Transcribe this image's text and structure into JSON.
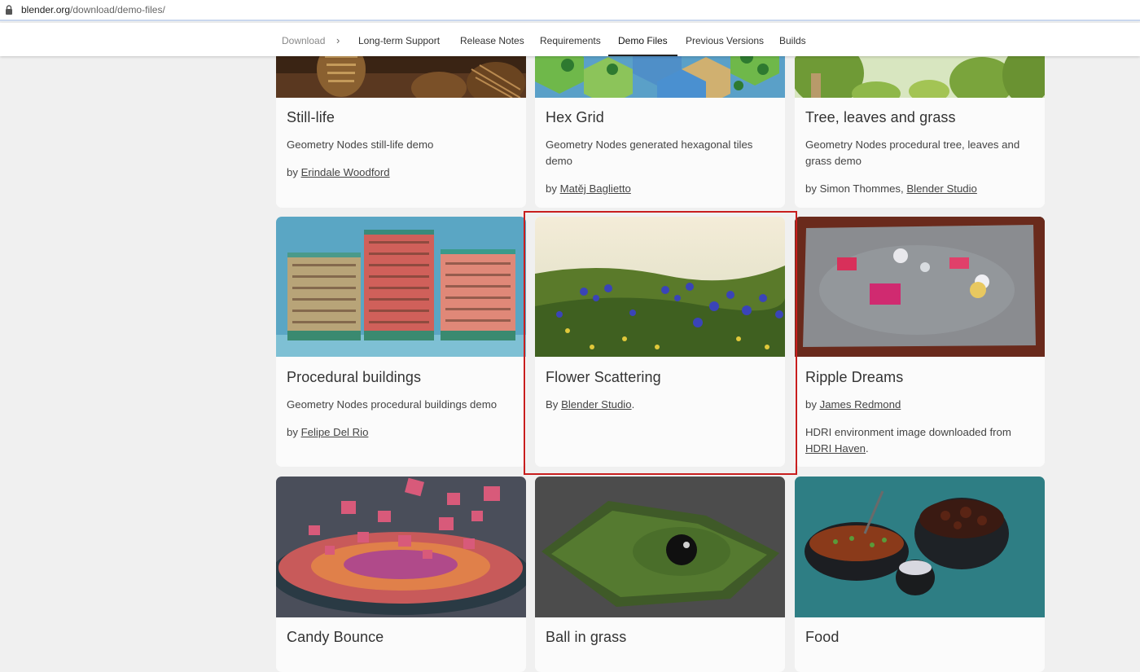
{
  "browser": {
    "url_host": "blender.org",
    "url_path": "/download/demo-files/"
  },
  "nav": {
    "download": "Download",
    "separator": "›",
    "items": [
      "Long-term Support",
      "Release Notes",
      "Requirements",
      "Demo Files",
      "Previous Versions",
      "Builds"
    ],
    "active": "Demo Files"
  },
  "cards": [
    {
      "title": "Still-life",
      "desc": "Geometry Nodes still-life demo",
      "by_prefix": "by ",
      "author": "Erindale Woodford",
      "image": "still-life-thumbnail"
    },
    {
      "title": "Hex Grid",
      "desc": "Geometry Nodes generated hexagonal tiles demo",
      "by_prefix": "by ",
      "author": "Matěj Baglietto",
      "image": "hex-grid-thumbnail"
    },
    {
      "title": "Tree, leaves and grass",
      "desc": "Geometry Nodes procedural tree, leaves and grass demo",
      "by_prefix": "by Simon Thommes, ",
      "author": "Blender Studio",
      "image": "tree-thumbnail"
    },
    {
      "title": "Procedural buildings",
      "desc": "Geometry Nodes procedural buildings demo",
      "by_prefix": "by ",
      "author": "Felipe Del Rio",
      "image": "buildings-thumbnail"
    },
    {
      "title": "Flower Scattering",
      "by_prefix": "By ",
      "author": "Blender Studio",
      "by_suffix": ".",
      "image": "flower-thumbnail"
    },
    {
      "title": "Ripple Dreams",
      "by_prefix": "by ",
      "author": "James Redmond",
      "note": "HDRI environment image downloaded from ",
      "note_link": "HDRI Haven",
      "note_suffix": ".",
      "image": "ripple-thumbnail"
    },
    {
      "title": "Candy Bounce",
      "image": "candy-thumbnail"
    },
    {
      "title": "Ball in grass",
      "image": "ball-grass-thumbnail"
    },
    {
      "title": "Food",
      "image": "food-thumbnail"
    }
  ],
  "colors": {
    "highlight": "#c81e1e",
    "page_bg": "#f0f0f0"
  }
}
